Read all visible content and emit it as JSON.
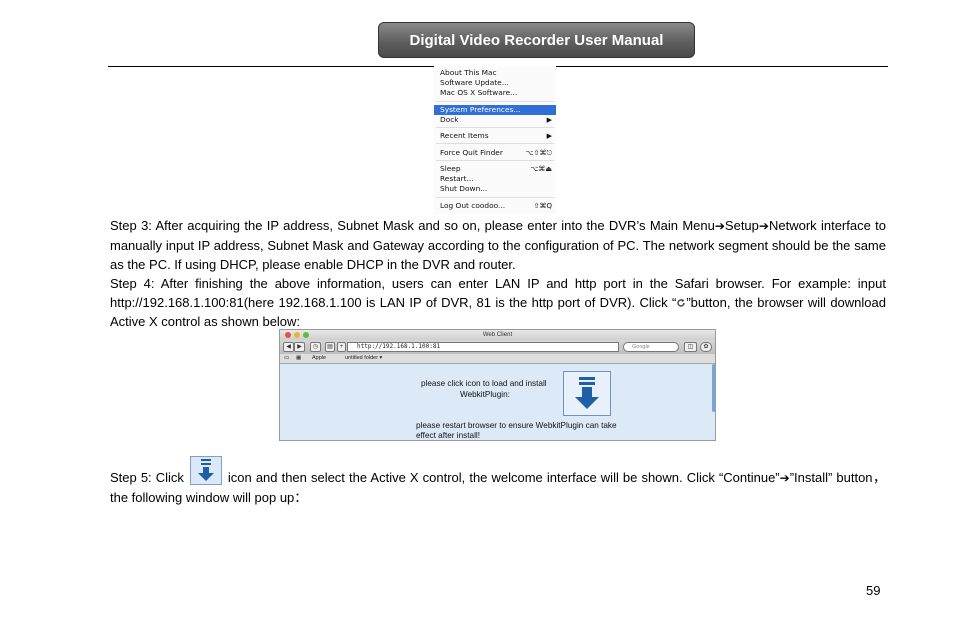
{
  "header": {
    "title": "Digital Video Recorder User Manual"
  },
  "apple_menu": {
    "items": [
      {
        "label": "About This Mac",
        "shortcut": ""
      },
      {
        "label": "Software Update...",
        "shortcut": ""
      },
      {
        "label": "Mac OS X Software...",
        "shortcut": ""
      },
      {
        "label": "System Preferences...",
        "shortcut": ""
      },
      {
        "label": "Dock",
        "shortcut": "▶"
      },
      {
        "label": "Recent Items",
        "shortcut": "▶"
      },
      {
        "label": "Force Quit Finder",
        "shortcut": "⌥⇧⌘⎋"
      },
      {
        "label": "Sleep",
        "shortcut": "⌥⌘⏏"
      },
      {
        "label": "Restart...",
        "shortcut": ""
      },
      {
        "label": "Shut Down...",
        "shortcut": ""
      },
      {
        "label": "Log Out coodoo...",
        "shortcut": "⇧⌘Q"
      }
    ]
  },
  "step3": {
    "part1": "Step 3: After acquiring the IP address, Subnet Mask and so on, please enter into the DVR’s Main Menu",
    "arrow": "➔",
    "part2": "Setup",
    "part3": "Network interface to manually input IP address, Subnet Mask and Gateway according to the configuration of PC. The network segment should be the same as the PC. If using DHCP, please enable DHCP in the DVR and router."
  },
  "step4": {
    "part1": "Step 4: After finishing the above information, users can enter LAN IP and http port in the Safari browser. For example: input http://192.168.1.100:81(here 192.168.1.100 is LAN IP of DVR, 81 is the http port of DVR). Click “",
    "part2": "”button, the browser will download Active X control as shown below:"
  },
  "safari": {
    "window_title": "Web Client",
    "url": "http://192.168.1.100:81",
    "search_placeholder": "Google",
    "bookmarks": [
      "Apple",
      "untitled folder ▾"
    ],
    "msg1": "please click icon to load and install",
    "msg2": "WebkitPlugin:",
    "msg3": "please restart browser to ensure WebkitPlugin can take",
    "msg4": "effect after install!"
  },
  "step5": {
    "part1": "Step 5: Click",
    "part2": "icon and then select the Active X control, the welcome interface will be shown. Click “Continue”",
    "arrow": "➔",
    "part3": "”Install” button，the following window will pop up："
  },
  "page_number": "59",
  "colors": {
    "menu_highlight": "#2f6fd6",
    "plugin_arrow": "#1f5fa8",
    "header_bg": "#5f5f5f"
  }
}
